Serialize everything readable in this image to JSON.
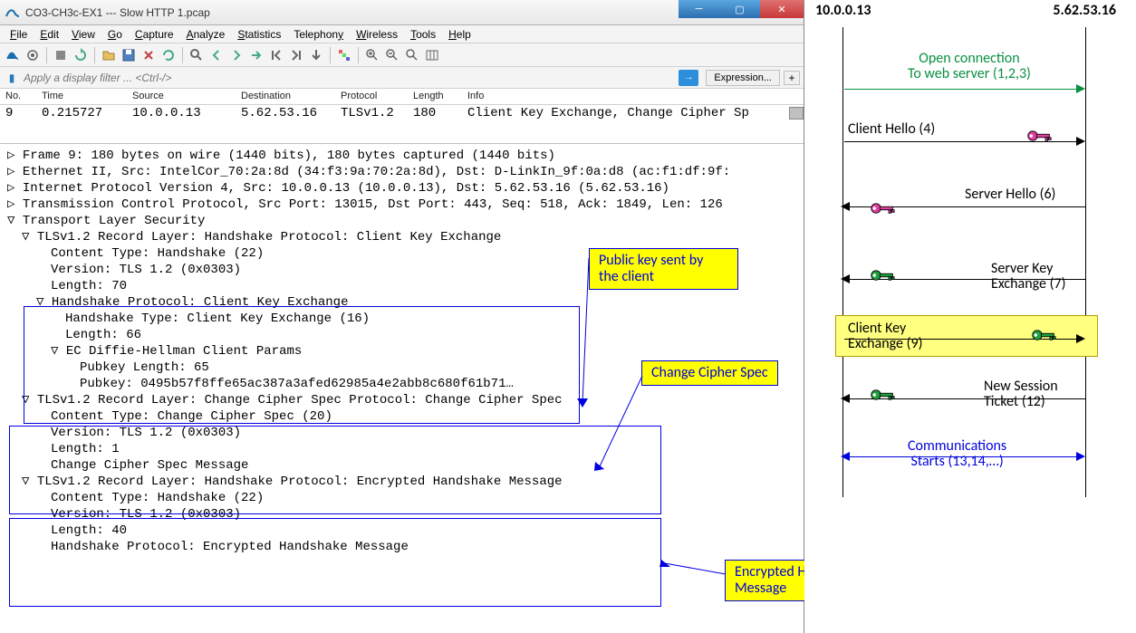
{
  "window": {
    "title": "CO3-CH3c-EX1 --- Slow HTTP 1.pcap"
  },
  "menu": [
    "File",
    "Edit",
    "View",
    "Go",
    "Capture",
    "Analyze",
    "Statistics",
    "Telephony",
    "Wireless",
    "Tools",
    "Help"
  ],
  "filter": {
    "placeholder": "Apply a display filter ... <Ctrl-/>",
    "expr": "Expression...",
    "plus": "+"
  },
  "cols": {
    "no": "No.",
    "time": "Time",
    "src": "Source",
    "dst": "Destination",
    "proto": "Protocol",
    "len": "Length",
    "info": "Info"
  },
  "row": {
    "no": "9",
    "time": "0.215727",
    "src": "10.0.0.13",
    "dst": "5.62.53.16",
    "proto": "TLSv1.2",
    "len": "180",
    "info": "Client Key Exchange, Change Cipher Sp"
  },
  "tree": [
    "▹ Frame 9: 180 bytes on wire (1440 bits), 180 bytes captured (1440 bits)",
    "▹ Ethernet II, Src: IntelCor_70:2a:8d (34:f3:9a:70:2a:8d), Dst: D-LinkIn_9f:0a:d8 (ac:f1:df:9f:",
    "▹ Internet Protocol Version 4, Src: 10.0.0.13 (10.0.0.13), Dst: 5.62.53.16 (5.62.53.16)",
    "▹ Transmission Control Protocol, Src Port: 13015, Dst Port: 443, Seq: 518, Ack: 1849, Len: 126",
    "▿ Transport Layer Security",
    "  ▿ TLSv1.2 Record Layer: Handshake Protocol: Client Key Exchange",
    "      Content Type: Handshake (22)",
    "      Version: TLS 1.2 (0x0303)",
    "      Length: 70",
    "    ▿ Handshake Protocol: Client Key Exchange",
    "        Handshake Type: Client Key Exchange (16)",
    "        Length: 66",
    "      ▿ EC Diffie-Hellman Client Params",
    "          Pubkey Length: 65",
    "          Pubkey: 0495b57f8ffe65ac387a3afed62985a4e2abb8c680f61b71…",
    "  ▿ TLSv1.2 Record Layer: Change Cipher Spec Protocol: Change Cipher Spec",
    "      Content Type: Change Cipher Spec (20)",
    "      Version: TLS 1.2 (0x0303)",
    "      Length: 1",
    "      Change Cipher Spec Message",
    "  ▿ TLSv1.2 Record Layer: Handshake Protocol: Encrypted Handshake Message",
    "      Content Type: Handshake (22)",
    "      Version: TLS 1.2 (0x0303)",
    "      Length: 40",
    "      Handshake Protocol: Encrypted Handshake Message"
  ],
  "callouts": {
    "c1a": "Public key sent by",
    "c1b": "the client",
    "c2": "Change Cipher Spec",
    "c3a": "Encrypted Handshake",
    "c3b": "Message"
  },
  "seq": {
    "left": "10.0.0.13",
    "right": "5.62.53.16",
    "m1a": "Open connection",
    "m1b": "To web server (1,2,3)",
    "m2": "Client Hello (4)",
    "m3": "Server Hello (6)",
    "m4a": "Server Key",
    "m4b": "Exchange (7)",
    "m5a": "Client Key",
    "m5b": "Exchange (9)",
    "m6a": "New Session",
    "m6b": "Ticket (12)",
    "m7a": "Communications",
    "m7b": "Starts (13,14,…)"
  }
}
